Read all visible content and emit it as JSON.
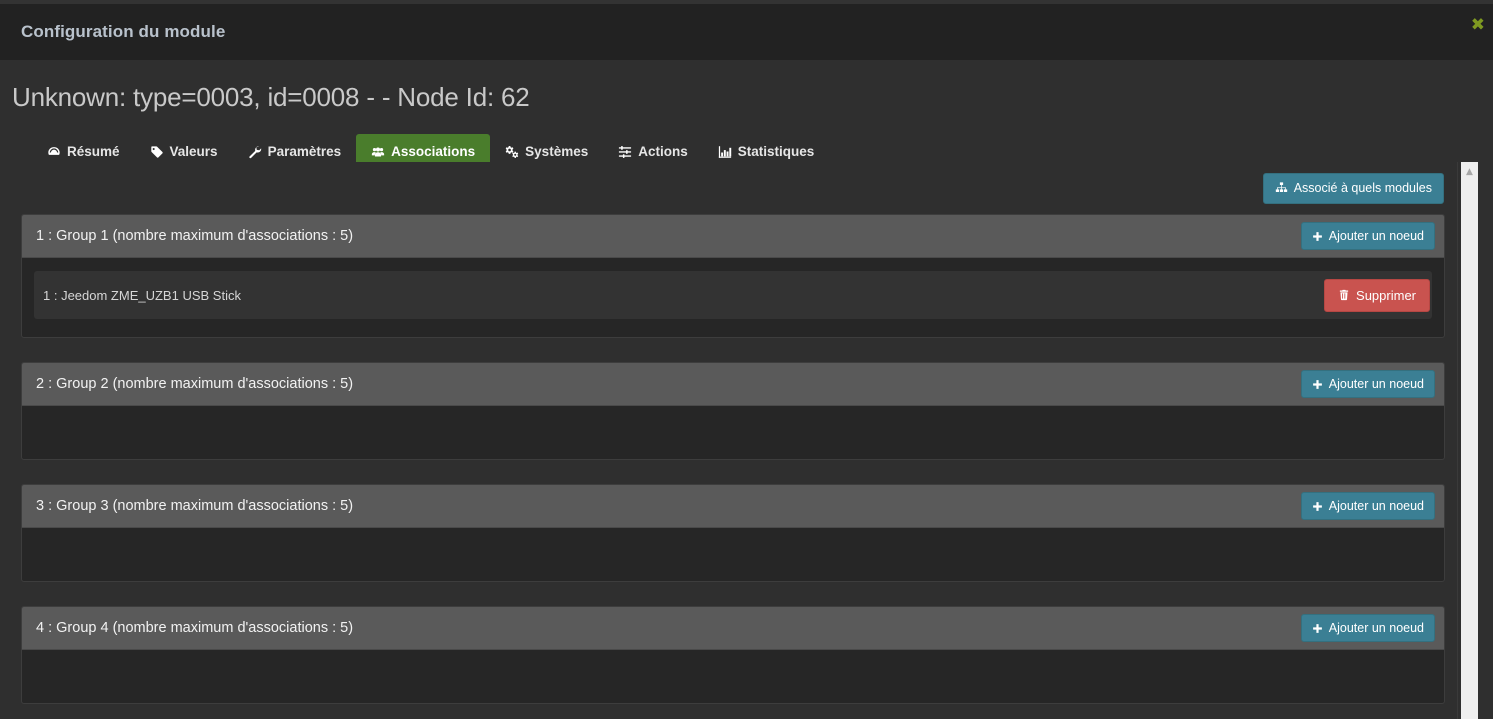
{
  "modal": {
    "title": "Configuration du module",
    "close_label": "✖",
    "close_color": "#7f9a21"
  },
  "page": {
    "heading": "Unknown: type=0003, id=0008 - - Node Id: 62"
  },
  "tabs": [
    {
      "label": "Résumé",
      "icon": "dashboard-icon",
      "active": false
    },
    {
      "label": "Valeurs",
      "icon": "tag-icon",
      "active": false
    },
    {
      "label": "Paramètres",
      "icon": "wrench-icon",
      "active": false
    },
    {
      "label": "Associations",
      "icon": "users-icon",
      "active": true
    },
    {
      "label": "Systèmes",
      "icon": "cogs-icon",
      "active": false
    },
    {
      "label": "Actions",
      "icon": "sliders-icon",
      "active": false
    },
    {
      "label": "Statistiques",
      "icon": "bar-chart-icon",
      "active": false
    }
  ],
  "toolbar": {
    "associated_modules_label": "Associé à quels modules",
    "associated_modules_icon": "sitemap-icon"
  },
  "labels": {
    "add_node": "Ajouter un noeud",
    "add_node_icon": "plus-icon",
    "delete": "Supprimer",
    "delete_icon": "trash-icon"
  },
  "groups": [
    {
      "title": "1 : Group 1 (nombre maximum d'associations : 5)",
      "associations": [
        {
          "label": "1 : Jeedom ZME_UZB1 USB Stick"
        }
      ]
    },
    {
      "title": "2 : Group 2 (nombre maximum d'associations : 5)",
      "associations": []
    },
    {
      "title": "3 : Group 3 (nombre maximum d'associations : 5)",
      "associations": []
    },
    {
      "title": "4 : Group 4 (nombre maximum d'associations : 5)",
      "associations": []
    }
  ],
  "scrollbar": {
    "up_arrow": "▲"
  },
  "colors": {
    "accent_green": "#4a7d2c",
    "btn_info": "#3b7f94",
    "btn_danger": "#c9534f",
    "panel_heading": "#5a5a5a",
    "panel_body": "#262626",
    "page_bg": "#2f2f2f"
  }
}
